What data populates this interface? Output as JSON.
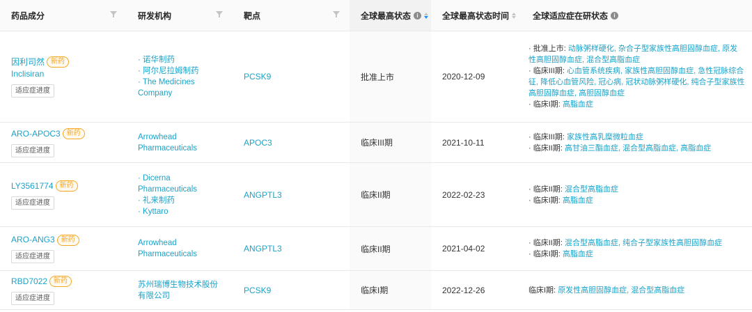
{
  "headers": {
    "drug": "药品成分",
    "org": "研发机构",
    "target": "靶点",
    "status": "全球最高状态",
    "status_time": "全球最高状态时间",
    "indications": "全球适应症在研状态"
  },
  "icons": {
    "info": "info-icon",
    "filter": "filter-icon",
    "sort": "sort-icon"
  },
  "colors": {
    "link": "#1aa3c9",
    "new_tag": "#f5a623"
  },
  "rows": [
    {
      "drug_cn": "因利司然",
      "tag": "新药",
      "drug_en": "Inclisiran",
      "btn": "适应症进度",
      "orgs": [
        "诺华制药",
        "阿尔尼拉姆制药",
        "The Medicines Company"
      ],
      "target": "PCSK9",
      "status": "批准上市",
      "date": "2020-12-09",
      "ind": [
        {
          "label": "批准上市:",
          "items": "动脉粥样硬化, 杂合子型家族性高胆固醇血症, 原发性高胆固醇血症, 混合型高脂血症"
        },
        {
          "label": "临床III期:",
          "items": "心血管系统疾病, 家族性高胆固醇血症, 急性冠脉综合征, 降低心血管风险, 冠心病, 冠状动脉粥样硬化, 纯合子型家族性高胆固醇血症, 高胆固醇血症"
        },
        {
          "label": "临床I期:",
          "items": "高脂血症"
        }
      ]
    },
    {
      "drug_cn": "ARO-APOC3",
      "tag": "新药",
      "drug_en": "",
      "btn": "适应症进度",
      "orgs": [
        "Arrowhead Pharmaceuticals"
      ],
      "target": "APOC3",
      "status": "临床III期",
      "date": "2021-10-11",
      "ind": [
        {
          "label": "临床III期:",
          "items": "家族性高乳糜微粒血症"
        },
        {
          "label": "临床II期:",
          "items": "高甘油三酯血症, 混合型高脂血症, 高脂血症"
        }
      ]
    },
    {
      "drug_cn": "LY3561774",
      "tag": "新药",
      "drug_en": "",
      "btn": "适应症进度",
      "orgs": [
        "Dicerna Pharmaceuticals",
        "礼来制药",
        "Kyttaro"
      ],
      "target": "ANGPTL3",
      "status": "临床II期",
      "date": "2022-02-23",
      "ind": [
        {
          "label": "临床II期:",
          "items": "混合型高脂血症"
        },
        {
          "label": "临床I期:",
          "items": "高脂血症"
        }
      ]
    },
    {
      "drug_cn": "ARO-ANG3",
      "tag": "新药",
      "drug_en": "",
      "btn": "适应症进度",
      "orgs": [
        "Arrowhead Pharmaceuticals"
      ],
      "target": "ANGPTL3",
      "status": "临床II期",
      "date": "2021-04-02",
      "ind": [
        {
          "label": "临床II期:",
          "items": "混合型高脂血症, 纯合子型家族性高胆固醇血症"
        },
        {
          "label": "临床I期:",
          "items": "高脂血症"
        }
      ]
    },
    {
      "drug_cn": "RBD7022",
      "tag": "新药",
      "drug_en": "",
      "btn": "适应症进度",
      "orgs": [
        "苏州瑞博生物技术股份有限公司"
      ],
      "target": "PCSK9",
      "status": "临床I期",
      "date": "2022-12-26",
      "ind": [
        {
          "label": "临床I期:",
          "items": "原发性高胆固醇血症, 混合型高脂血症"
        }
      ]
    }
  ]
}
